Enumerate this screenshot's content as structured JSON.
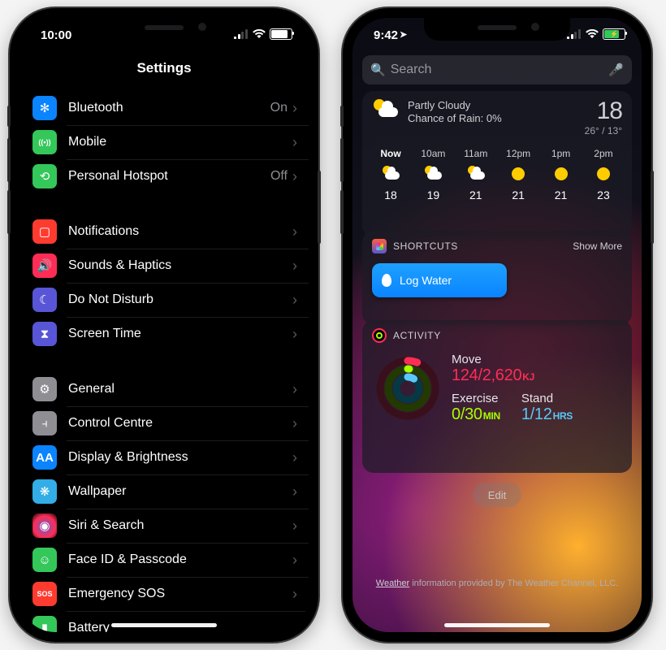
{
  "left": {
    "status": {
      "time": "10:00",
      "signal_active_bars": 2,
      "battery_pct": 78,
      "charging": false
    },
    "title": "Settings",
    "groups": [
      [
        {
          "icon": "bluetooth-icon",
          "glyph": "✻",
          "color": "#0a84ff",
          "label": "Bluetooth",
          "value": "On"
        },
        {
          "icon": "antenna-icon",
          "glyph": "((•))",
          "color": "#34c759",
          "label": "Mobile",
          "value": ""
        },
        {
          "icon": "link-icon",
          "glyph": "⟲",
          "color": "#34c759",
          "label": "Personal Hotspot",
          "value": "Off"
        }
      ],
      [
        {
          "icon": "notifications-icon",
          "glyph": "▢",
          "color": "#ff3b30",
          "label": "Notifications",
          "value": ""
        },
        {
          "icon": "speaker-icon",
          "glyph": "🔊",
          "color": "#ff2d55",
          "label": "Sounds & Haptics",
          "value": ""
        },
        {
          "icon": "moon-icon",
          "glyph": "☾",
          "color": "#5856d6",
          "label": "Do Not Disturb",
          "value": ""
        },
        {
          "icon": "hourglass-icon",
          "glyph": "⧗",
          "color": "#5856d6",
          "label": "Screen Time",
          "value": ""
        }
      ],
      [
        {
          "icon": "gear-icon",
          "glyph": "⚙",
          "color": "#8e8e93",
          "label": "General",
          "value": ""
        },
        {
          "icon": "switches-icon",
          "glyph": "⫞",
          "color": "#8e8e93",
          "label": "Control Centre",
          "value": ""
        },
        {
          "icon": "text-size-icon",
          "glyph": "AA",
          "color": "#0a84ff",
          "label": "Display & Brightness",
          "value": ""
        },
        {
          "icon": "flower-icon",
          "glyph": "❋",
          "color": "#32ade6",
          "label": "Wallpaper",
          "value": ""
        },
        {
          "icon": "siri-icon",
          "glyph": "◉",
          "color": "#1c1c1e",
          "label": "Siri & Search",
          "value": ""
        },
        {
          "icon": "faceid-icon",
          "glyph": "☺",
          "color": "#34c759",
          "label": "Face ID & Passcode",
          "value": ""
        },
        {
          "icon": "sos-icon",
          "glyph": "SOS",
          "color": "#ff3b30",
          "label": "Emergency SOS",
          "value": ""
        },
        {
          "icon": "battery-icon",
          "glyph": "▮",
          "color": "#34c759",
          "label": "Battery",
          "value": ""
        }
      ]
    ]
  },
  "right": {
    "status": {
      "time": "9:42",
      "location_arrow": true,
      "signal_active_bars": 2,
      "battery_pct": 70,
      "charging": true
    },
    "search": {
      "placeholder": "Search"
    },
    "weather": {
      "summary_line1": "Partly Cloudy",
      "summary_line2": "Chance of Rain: 0%",
      "temp_now": "18",
      "temp_hi": "26°",
      "temp_lo": "13°",
      "hours": [
        {
          "label": "Now",
          "cond": "pc",
          "temp": "18"
        },
        {
          "label": "10am",
          "cond": "pc",
          "temp": "19"
        },
        {
          "label": "11am",
          "cond": "pc",
          "temp": "21"
        },
        {
          "label": "12pm",
          "cond": "sun",
          "temp": "21"
        },
        {
          "label": "1pm",
          "cond": "sun",
          "temp": "21"
        },
        {
          "label": "2pm",
          "cond": "sun",
          "temp": "23"
        }
      ]
    },
    "shortcuts": {
      "header": "SHORTCUTS",
      "show_more": "Show More",
      "items": [
        {
          "label": "Log Water"
        }
      ]
    },
    "activity": {
      "header": "ACTIVITY",
      "move_label": "Move",
      "move_value": "124/2,620",
      "move_unit": "KJ",
      "exercise_label": "Exercise",
      "exercise_value": "0/30",
      "exercise_unit": "MIN",
      "stand_label": "Stand",
      "stand_value": "1/12",
      "stand_unit": "HRS"
    },
    "edit_label": "Edit",
    "footer_link": "Weather",
    "footer_rest": " information provided by The Weather Channel, LLC."
  }
}
